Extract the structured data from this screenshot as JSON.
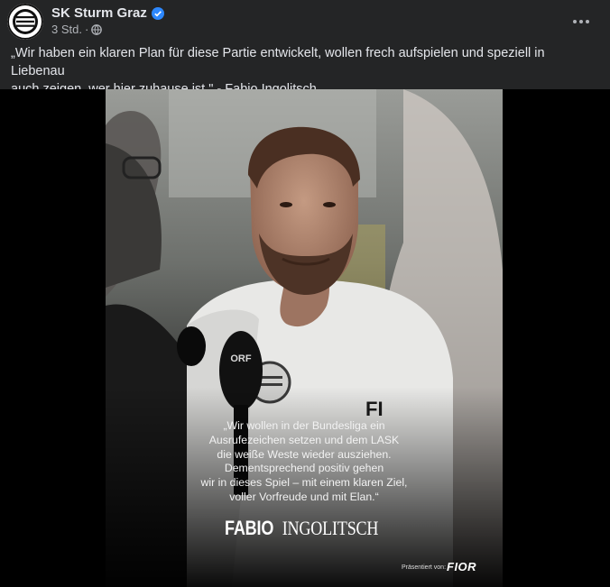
{
  "post": {
    "page_name": "SK Sturm Graz",
    "time": "3 Std.",
    "separator": "·",
    "caption": "„Wir haben ein klaren Plan für diese Partie entwickelt, wollen frech aufspielen und speziell in Liebenau\nauch zeigen, wer hier zuhause ist.\" - Fabio Ingolitsch",
    "more_label": "•••"
  },
  "graphic": {
    "quote": "„Wir wollen in der Bundesliga ein\nAusrufezeichen setzen und dem LASK\ndie weiße Weste wieder ausziehen.\nDementsprechend positiv gehen\nwir in dieses Spiel – mit einem klaren Ziel,\nvoller Vorfreude und mit Elan.“",
    "name_first": "FABIO",
    "name_last": "INGOLITSCH",
    "presented_by": "Präsentiert von:",
    "sponsor": "FIOR",
    "mic_logo": "ORF",
    "shirt_badge": "FI"
  },
  "colors": {
    "background": "#242526",
    "verified": "#2d88ff",
    "media_bg": "#000000"
  }
}
